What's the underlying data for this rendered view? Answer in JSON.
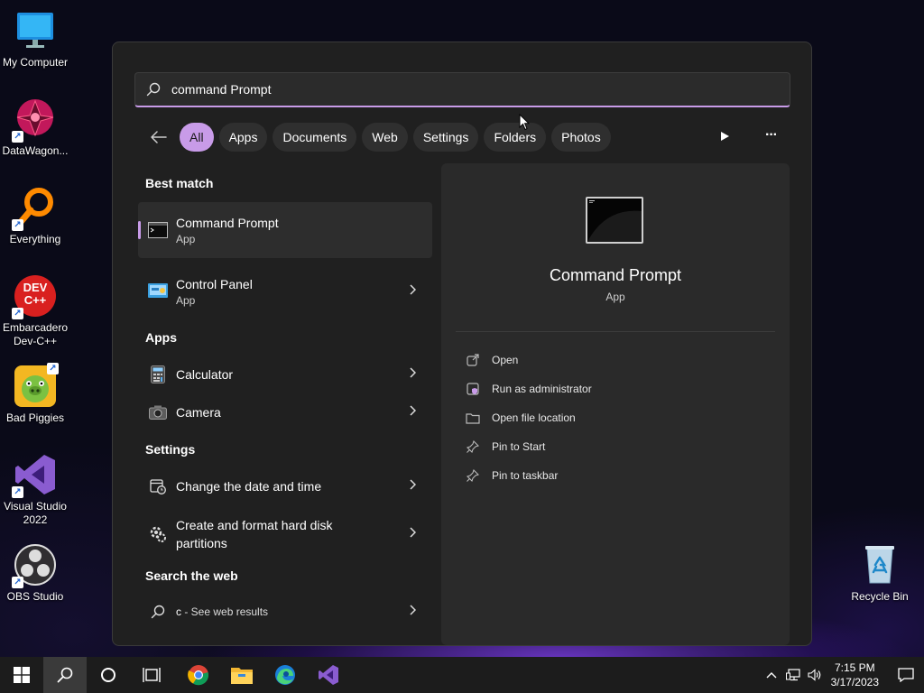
{
  "desktop": {
    "icons": [
      {
        "label": "My Computer"
      },
      {
        "label": "DataWagon..."
      },
      {
        "label": "Everything"
      },
      {
        "label": "Embarcadero Dev-C++"
      },
      {
        "label": "Bad Piggies"
      },
      {
        "label": "Visual Studio 2022"
      },
      {
        "label": "OBS Studio"
      },
      {
        "label": "Recycle Bin"
      }
    ],
    "devcpp_badge": "DEV",
    "devcpp_badge2": "C++"
  },
  "search": {
    "query": "command Prompt",
    "filters": [
      "All",
      "Apps",
      "Documents",
      "Web",
      "Settings",
      "Folders",
      "Photos"
    ],
    "active_filter": "All",
    "more_symbol": "···"
  },
  "results": {
    "best_match_heading": "Best match",
    "best_match": {
      "title": "Command Prompt",
      "subtitle": "App"
    },
    "best_match_second": {
      "title": "Control Panel",
      "subtitle": "App"
    },
    "apps_heading": "Apps",
    "apps": [
      {
        "title": "Calculator"
      },
      {
        "title": "Camera"
      }
    ],
    "settings_heading": "Settings",
    "settings": [
      {
        "title": "Change the date and time"
      },
      {
        "title": "Create and format hard disk partitions"
      }
    ],
    "web_heading": "Search the web",
    "web": {
      "query": "c",
      "suffix": " - See web results"
    }
  },
  "preview": {
    "title": "Command Prompt",
    "subtitle": "App",
    "actions": [
      {
        "label": "Open",
        "icon": "open-external-icon"
      },
      {
        "label": "Run as administrator",
        "icon": "admin-shield-icon"
      },
      {
        "label": "Open file location",
        "icon": "folder-icon"
      },
      {
        "label": "Pin to Start",
        "icon": "pin-icon"
      },
      {
        "label": "Pin to taskbar",
        "icon": "pin-icon"
      }
    ]
  },
  "taskbar": {
    "time": "7:15 PM",
    "date": "3/17/2023"
  },
  "colors": {
    "accent": "#c89be8",
    "panel": "#202020",
    "preview_panel": "#2a2a2a",
    "taskbar": "#1c1c1c"
  }
}
